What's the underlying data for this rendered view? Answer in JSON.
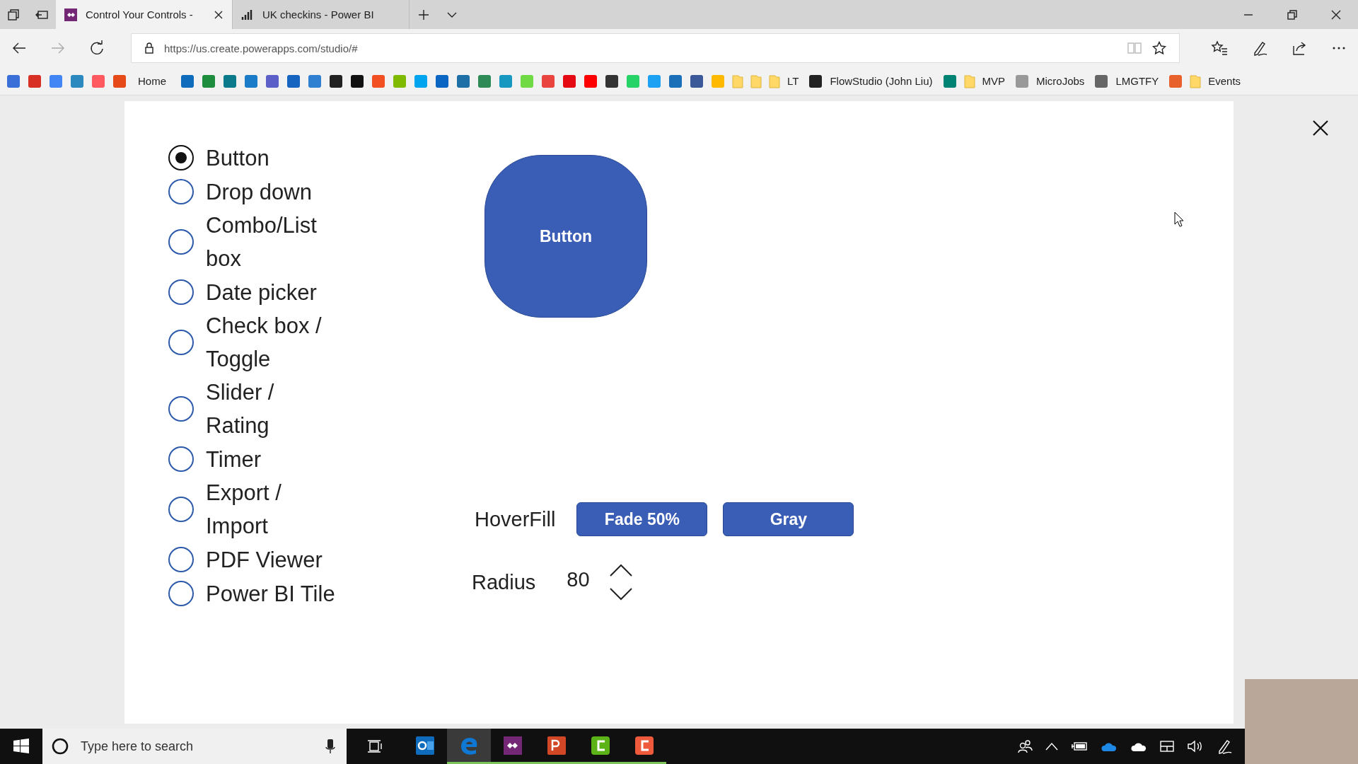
{
  "browser": {
    "tabs": [
      {
        "title": "Control Your Controls -",
        "kind": "apps",
        "selected": true
      },
      {
        "title": "UK checkins - Power BI",
        "kind": "chart",
        "selected": false
      }
    ],
    "address": "https://us.create.powerapps.com/studio/#",
    "bookmarks": [
      {
        "kind": "site",
        "color": "#3b6fd8"
      },
      {
        "kind": "site",
        "color": "#d93025"
      },
      {
        "kind": "site",
        "color": "#4285f4"
      },
      {
        "kind": "site",
        "color": "#2b89c0"
      },
      {
        "kind": "site",
        "color": "#ff5a5f"
      },
      {
        "kind": "site",
        "color": "#e64a19"
      },
      {
        "kind": "text",
        "label": "Home"
      },
      {
        "kind": "site",
        "color": "#0f6cbd"
      },
      {
        "kind": "site",
        "color": "#1e8e3e"
      },
      {
        "kind": "site",
        "color": "#0b7a8a"
      },
      {
        "kind": "site",
        "color": "#1a7bc9"
      },
      {
        "kind": "site",
        "color": "#5b5fc7"
      },
      {
        "kind": "site",
        "color": "#1565c0"
      },
      {
        "kind": "site",
        "color": "#2f80d1"
      },
      {
        "kind": "site",
        "color": "#222222"
      },
      {
        "kind": "site",
        "color": "#111111"
      },
      {
        "kind": "site",
        "color": "#f25022"
      },
      {
        "kind": "site",
        "color": "#7fba00"
      },
      {
        "kind": "site",
        "color": "#00a4ef"
      },
      {
        "kind": "site",
        "color": "#0a66c2"
      },
      {
        "kind": "site",
        "color": "#1d6fa5"
      },
      {
        "kind": "site",
        "color": "#2e8b57"
      },
      {
        "kind": "site",
        "color": "#1798c1"
      },
      {
        "kind": "site",
        "color": "#6fda44"
      },
      {
        "kind": "site",
        "color": "#e9453e"
      },
      {
        "kind": "site",
        "color": "#e50914"
      },
      {
        "kind": "site",
        "color": "#ff0000"
      },
      {
        "kind": "site",
        "color": "#333333"
      },
      {
        "kind": "site",
        "color": "#25d366"
      },
      {
        "kind": "site",
        "color": "#1da1f2"
      },
      {
        "kind": "site",
        "color": "#1b6fb8"
      },
      {
        "kind": "site",
        "color": "#3b5998"
      },
      {
        "kind": "site",
        "color": "#ffb900"
      },
      {
        "kind": "folder"
      },
      {
        "kind": "folder"
      },
      {
        "kind": "folder",
        "label": "LT"
      },
      {
        "kind": "site",
        "color": "#222222",
        "label": "FlowStudio (John Liu)"
      },
      {
        "kind": "site",
        "color": "#008373"
      },
      {
        "kind": "folder",
        "label": "MVP"
      },
      {
        "kind": "site",
        "color": "#999999",
        "label": "MicroJobs"
      },
      {
        "kind": "site",
        "color": "#666666",
        "label": "LMGTFY"
      },
      {
        "kind": "site",
        "color": "#e8602c"
      },
      {
        "kind": "folder",
        "label": "Events"
      }
    ]
  },
  "app": {
    "options": [
      {
        "label": "Button",
        "selected": true
      },
      {
        "label": "Drop down",
        "selected": false
      },
      {
        "label": "Combo/List box",
        "selected": false
      },
      {
        "label": "Date picker",
        "selected": false
      },
      {
        "label": "Check box / Toggle",
        "selected": false
      },
      {
        "label": "Slider / Rating",
        "selected": false
      },
      {
        "label": "Timer",
        "selected": false
      },
      {
        "label": "Export / Import",
        "selected": false
      },
      {
        "label": "PDF Viewer",
        "selected": false
      },
      {
        "label": "Power BI Tile",
        "selected": false
      }
    ],
    "preview_button": "Button",
    "hover_fill": {
      "label": "HoverFill",
      "options": [
        "Fade 50%",
        "Gray"
      ]
    },
    "radius": {
      "label": "Radius",
      "value": "80"
    }
  },
  "taskbar": {
    "search_placeholder": "Type here to search",
    "apps": [
      {
        "kind": "mail",
        "running": false,
        "active": false
      },
      {
        "kind": "browser",
        "running": true,
        "active": true
      },
      {
        "kind": "apps",
        "running": true,
        "active": false
      },
      {
        "kind": "slides",
        "running": true,
        "active": false
      },
      {
        "kind": "recorder",
        "running": true,
        "active": false
      },
      {
        "kind": "recorder2",
        "running": true,
        "active": false
      }
    ]
  }
}
